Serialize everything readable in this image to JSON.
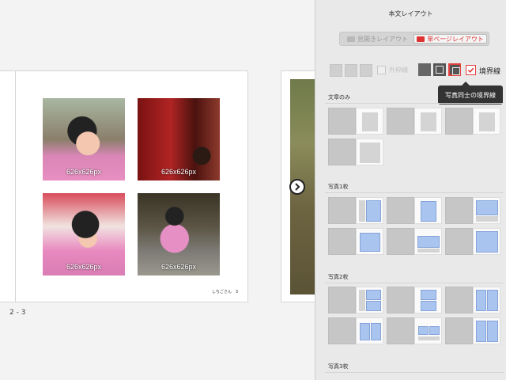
{
  "canvas": {
    "photo_size_label": "626x626px",
    "footer_text": "しちごさん　3",
    "spread_label": "2 - 3"
  },
  "sidebar": {
    "title": "本文レイアウト",
    "mode_toggle": {
      "spread_label": "見開きレイアウト",
      "single_label": "単ページレイアウト",
      "selected": "single"
    },
    "borders": {
      "outer_label": "外枠線",
      "outer_checked": false,
      "inner_label": "境界線",
      "inner_checked": true
    },
    "tooltip": "写真同士の境界線",
    "sections": [
      {
        "title": "文章のみ"
      },
      {
        "title": "写真1枚"
      },
      {
        "title": "写真2枚"
      },
      {
        "title": "写真3枚"
      }
    ]
  },
  "colors": {
    "accent": "#e23e3e",
    "placeholder_blue": "#aac4f0",
    "panel_bg": "#e9e9e9"
  },
  "icons": {
    "next_page": "chevron-right-icon",
    "check": "checkmark-icon"
  }
}
